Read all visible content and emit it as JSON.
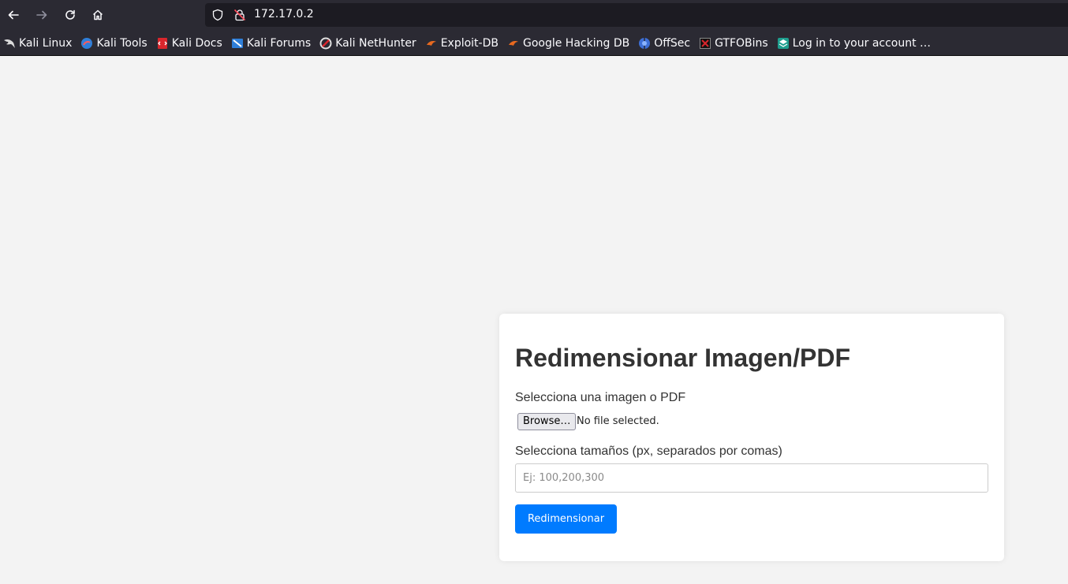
{
  "browser": {
    "url": "172.17.0.2",
    "bookmarks": [
      {
        "label": "Kali Linux",
        "icon": "kali-dragon-icon"
      },
      {
        "label": "Kali Tools",
        "icon": "kali-tools-icon"
      },
      {
        "label": "Kali Docs",
        "icon": "kali-docs-icon"
      },
      {
        "label": "Kali Forums",
        "icon": "kali-forums-icon"
      },
      {
        "label": "Kali NetHunter",
        "icon": "kali-nethunter-icon"
      },
      {
        "label": "Exploit-DB",
        "icon": "exploit-db-icon"
      },
      {
        "label": "Google Hacking DB",
        "icon": "ghdb-icon"
      },
      {
        "label": "OffSec",
        "icon": "offsec-icon"
      },
      {
        "label": "GTFOBins",
        "icon": "gtfobins-icon"
      },
      {
        "label": "Log in to your account …",
        "icon": "login-site-icon"
      }
    ]
  },
  "form": {
    "title": "Redimensionar Imagen/PDF",
    "file_label": "Selecciona una imagen o PDF",
    "browse_label": "Browse…",
    "file_status": "No file selected.",
    "sizes_label": "Selecciona tamaños (px, separados por comas)",
    "sizes_placeholder": "Ej: 100,200,300",
    "sizes_value": "",
    "submit_label": "Redimensionar"
  },
  "colors": {
    "primary_button": "#007bff",
    "page_background": "#f3f3f3",
    "chrome_background": "#2b2a33"
  }
}
